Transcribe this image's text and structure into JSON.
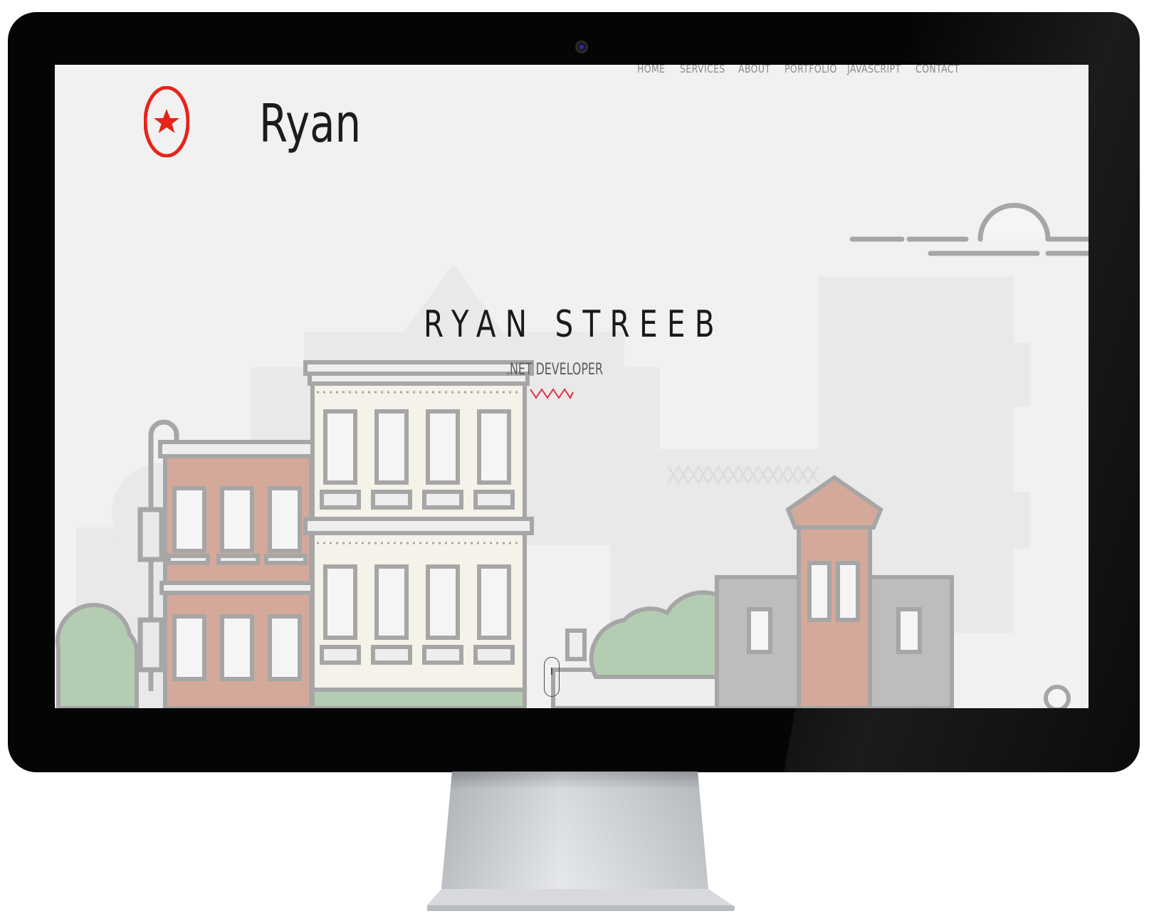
{
  "nav": {
    "items": [
      "HOME",
      "SERVICES",
      "ABOUT",
      "PORTFOLIO",
      "JAVASCRIPT",
      "CONTACT"
    ]
  },
  "brand": {
    "name": "Ryan",
    "logo_icon": "star-in-circle-icon",
    "logo_color": "#e8231a"
  },
  "hero": {
    "title": "RYAN STREEB",
    "subtitle": ".NET DEVELOPER",
    "accent_color": "#e0304a",
    "scroll_icon": "mouse-scroll-icon"
  },
  "colors": {
    "screen_bg": "#f2f2f2",
    "bezel": "#050505"
  }
}
